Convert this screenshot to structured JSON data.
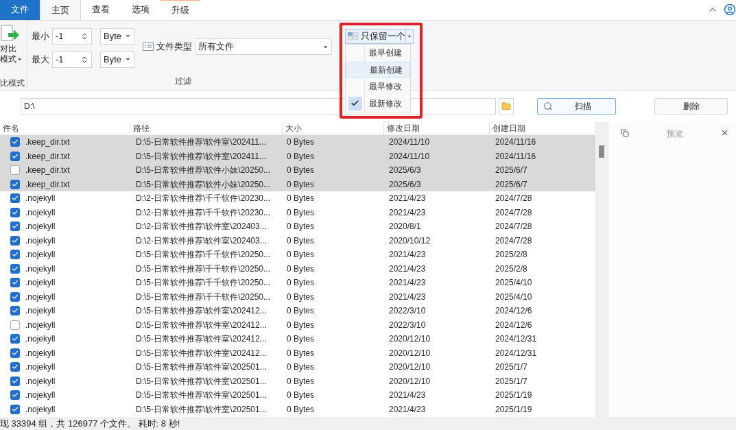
{
  "ribbon_tabs": [
    {
      "label": "文件",
      "kind": "file",
      "selected": false
    },
    {
      "label": "主页",
      "kind": "tab",
      "selected": true
    },
    {
      "label": "查看",
      "kind": "tab",
      "selected": false
    },
    {
      "label": "选项",
      "kind": "tab",
      "selected": false
    },
    {
      "label": "升级",
      "kind": "upgrade",
      "selected": false
    }
  ],
  "compare_group": {
    "button_label_1": "对比",
    "button_label_2": "模式",
    "caption": "比模式"
  },
  "filter_group": {
    "min_label": "最小",
    "min_value": "-1",
    "min_unit": "Byte",
    "max_label": "最大",
    "max_value": "-1",
    "max_unit": "Byte",
    "type_label": "文件类型",
    "type_value": "所有文件",
    "caption": "过滤"
  },
  "keep_dropdown": {
    "label": "只保留一个",
    "items": [
      {
        "label": "最早创建",
        "checked": false,
        "highlighted": false
      },
      {
        "label": "最新创建",
        "checked": false,
        "highlighted": true
      },
      {
        "label": "最早修改",
        "checked": false,
        "highlighted": false
      },
      {
        "label": "最新修改",
        "checked": true,
        "highlighted": false
      }
    ]
  },
  "path_field": {
    "value": "D:\\"
  },
  "scan_button": "扫描",
  "delete_button": "删除",
  "table": {
    "columns": [
      "件名",
      "路径",
      "大小",
      "修改日期",
      "创建日期"
    ],
    "rows": [
      {
        "checked": true,
        "highlighted": true,
        "name": ".keep_dir.txt",
        "path": "D:\\5-日常软件推荐\\软件室\\202411...",
        "size": "0 Bytes",
        "modified": "2024/11/10",
        "created": "2024/11/16"
      },
      {
        "checked": true,
        "highlighted": true,
        "name": ".keep_dir.txt",
        "path": "D:\\5-日常软件推荐\\软件室\\202411...",
        "size": "0 Bytes",
        "modified": "2024/11/10",
        "created": "2024/11/16"
      },
      {
        "checked": false,
        "highlighted": true,
        "name": ".keep_dir.txt",
        "path": "D:\\5-日常软件推荐\\软件小妹\\20250...",
        "size": "0 Bytes",
        "modified": "2025/6/3",
        "created": "2025/6/7"
      },
      {
        "checked": true,
        "highlighted": true,
        "name": ".keep_dir.txt",
        "path": "D:\\5-日常软件推荐\\软件小妹\\20250...",
        "size": "0 Bytes",
        "modified": "2025/6/3",
        "created": "2025/6/7"
      },
      {
        "checked": true,
        "highlighted": false,
        "name": ".nojekyll",
        "path": "D:\\2-日常软件推荐\\千千软件\\20230...",
        "size": "0 Bytes",
        "modified": "2021/4/23",
        "created": "2024/7/28"
      },
      {
        "checked": true,
        "highlighted": false,
        "name": ".nojekyll",
        "path": "D:\\2-日常软件推荐\\千千软件\\20230...",
        "size": "0 Bytes",
        "modified": "2021/4/23",
        "created": "2024/7/28"
      },
      {
        "checked": true,
        "highlighted": false,
        "name": ".nojekyll",
        "path": "D:\\2-日常软件推荐\\软件室\\202403...",
        "size": "0 Bytes",
        "modified": "2020/8/1",
        "created": "2024/7/28"
      },
      {
        "checked": true,
        "highlighted": false,
        "name": ".nojekyll",
        "path": "D:\\2-日常软件推荐\\软件室\\202403...",
        "size": "0 Bytes",
        "modified": "2020/10/12",
        "created": "2024/7/28"
      },
      {
        "checked": true,
        "highlighted": false,
        "name": ".nojekyll",
        "path": "D:\\5-日常软件推荐\\千千软件\\20250...",
        "size": "0 Bytes",
        "modified": "2021/4/23",
        "created": "2025/2/8"
      },
      {
        "checked": true,
        "highlighted": false,
        "name": ".nojekyll",
        "path": "D:\\5-日常软件推荐\\千千软件\\20250...",
        "size": "0 Bytes",
        "modified": "2021/4/23",
        "created": "2025/2/8"
      },
      {
        "checked": true,
        "highlighted": false,
        "name": ".nojekyll",
        "path": "D:\\5-日常软件推荐\\千千软件\\20250...",
        "size": "0 Bytes",
        "modified": "2021/4/23",
        "created": "2025/4/10"
      },
      {
        "checked": true,
        "highlighted": false,
        "name": ".nojekyll",
        "path": "D:\\5-日常软件推荐\\千千软件\\20250...",
        "size": "0 Bytes",
        "modified": "2021/4/23",
        "created": "2025/4/10"
      },
      {
        "checked": true,
        "highlighted": false,
        "name": ".nojekyll",
        "path": "D:\\5-日常软件推荐\\软件室\\202412...",
        "size": "0 Bytes",
        "modified": "2022/3/10",
        "created": "2024/12/6"
      },
      {
        "checked": false,
        "highlighted": false,
        "name": ".nojekyll",
        "path": "D:\\5-日常软件推荐\\软件室\\202412...",
        "size": "0 Bytes",
        "modified": "2022/3/10",
        "created": "2024/12/6"
      },
      {
        "checked": true,
        "highlighted": false,
        "name": ".nojekyll",
        "path": "D:\\5-日常软件推荐\\软件室\\202412...",
        "size": "0 Bytes",
        "modified": "2020/12/10",
        "created": "2024/12/31"
      },
      {
        "checked": true,
        "highlighted": false,
        "name": ".nojekyll",
        "path": "D:\\5-日常软件推荐\\软件室\\202412...",
        "size": "0 Bytes",
        "modified": "2020/12/10",
        "created": "2024/12/31"
      },
      {
        "checked": true,
        "highlighted": false,
        "name": ".nojekyll",
        "path": "D:\\5-日常软件推荐\\软件室\\202501...",
        "size": "0 Bytes",
        "modified": "2020/12/10",
        "created": "2025/1/7"
      },
      {
        "checked": true,
        "highlighted": false,
        "name": ".nojekyll",
        "path": "D:\\5-日常软件推荐\\软件室\\202501...",
        "size": "0 Bytes",
        "modified": "2020/12/10",
        "created": "2025/1/7"
      },
      {
        "checked": true,
        "highlighted": false,
        "name": ".nojekyll",
        "path": "D:\\5-日常软件推荐\\软件室\\202501...",
        "size": "0 Bytes",
        "modified": "2021/4/23",
        "created": "2025/1/19"
      },
      {
        "checked": true,
        "highlighted": false,
        "name": ".nojekyll",
        "path": "D:\\5-日常软件推荐\\软件室\\202501...",
        "size": "0 Bytes",
        "modified": "2021/4/23",
        "created": "2025/1/19"
      }
    ]
  },
  "preview_panel": {
    "title": "预览"
  },
  "status_bar": "现 33394 组，共 126977 个文件。 耗时: 8 秒!"
}
